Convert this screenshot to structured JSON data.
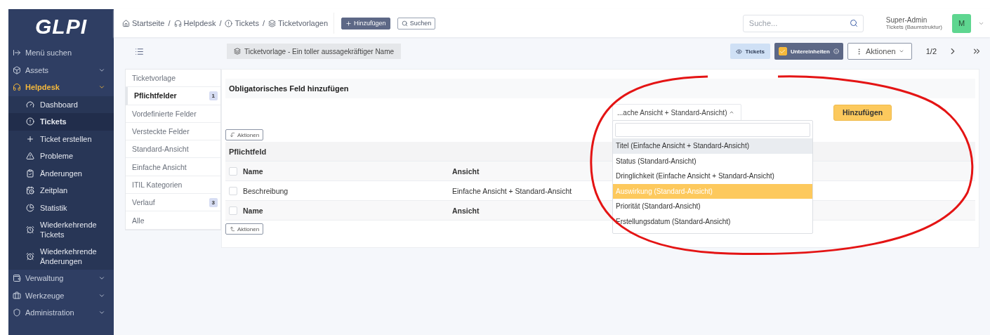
{
  "logo": "GLPI",
  "sidebar": {
    "items": [
      {
        "label": "Menü suchen",
        "expandable": false,
        "active": false
      },
      {
        "label": "Assets",
        "expandable": true,
        "active": false
      },
      {
        "label": "Helpdesk",
        "expandable": true,
        "active": true,
        "children": [
          {
            "label": "Dashboard",
            "selected": false
          },
          {
            "label": "Tickets",
            "selected": true
          },
          {
            "label": "Ticket erstellen",
            "selected": false
          },
          {
            "label": "Probleme",
            "selected": false
          },
          {
            "label": "Änderungen",
            "selected": false
          },
          {
            "label": "Zeitplan",
            "selected": false
          },
          {
            "label": "Statistik",
            "selected": false
          },
          {
            "label": "Wiederkehrende Tickets",
            "selected": false
          },
          {
            "label": "Wiederkehrende Änderungen",
            "selected": false
          }
        ]
      },
      {
        "label": "Verwaltung",
        "expandable": true,
        "active": false
      },
      {
        "label": "Werkzeuge",
        "expandable": true,
        "active": false
      },
      {
        "label": "Administration",
        "expandable": true,
        "active": false
      }
    ]
  },
  "breadcrumb": [
    {
      "kind": "link",
      "label": "Startseite"
    },
    {
      "kind": "separator",
      "label": "/"
    },
    {
      "kind": "link",
      "label": "Helpdesk"
    },
    {
      "kind": "separator",
      "label": "/"
    },
    {
      "kind": "link",
      "label": "Tickets"
    },
    {
      "kind": "separator",
      "label": "/"
    },
    {
      "kind": "link",
      "label": "Ticketvorlagen"
    }
  ],
  "header_buttons": {
    "add": "Hinzufügen",
    "search": "Suchen"
  },
  "global_search": {
    "placeholder": "Suche..."
  },
  "user": {
    "name": "Super-Admin",
    "entity": "Tickets (Baumstruktur)",
    "initial": "M"
  },
  "item_title": "Ticketvorlage - Ein toller aussagekräftiger Name",
  "toolbar": {
    "entity_badge": "Tickets",
    "subentities": {
      "label": "Untereinheiten",
      "checked": true
    },
    "actions": "Aktionen",
    "pager": "1/2"
  },
  "tabs": [
    {
      "label": "Ticketvorlage",
      "selected": false
    },
    {
      "label": "Pflichtfelder",
      "selected": true,
      "count": "1"
    },
    {
      "label": "Vordefinierte Felder",
      "selected": false
    },
    {
      "label": "Versteckte Felder",
      "selected": false
    },
    {
      "label": "Standard-Ansicht",
      "selected": false
    },
    {
      "label": "Einfache Ansicht",
      "selected": false
    },
    {
      "label": "ITIL Kategorien",
      "selected": false
    },
    {
      "label": "Verlauf",
      "selected": false,
      "count": "3"
    },
    {
      "label": "Alle",
      "selected": false
    }
  ],
  "add_section": {
    "title": "Obligatorisches Feld hinzufügen",
    "select_value": "...ache Ansicht + Standard-Ansicht)",
    "button": "Hinzufügen",
    "dropdown": {
      "open": true,
      "options": [
        {
          "label": "Titel (Einfache Ansicht + Standard-Ansicht)",
          "selected": true,
          "highlighted": false
        },
        {
          "label": "Status (Standard-Ansicht)",
          "selected": false,
          "highlighted": false
        },
        {
          "label": "Dringlichkeit (Einfache Ansicht + Standard-Ansicht)",
          "selected": false,
          "highlighted": false
        },
        {
          "label": "Auswirkung (Standard-Ansicht)",
          "selected": false,
          "highlighted": true
        },
        {
          "label": "Priorität (Standard-Ansicht)",
          "selected": false,
          "highlighted": false
        },
        {
          "label": "Erstellungsdatum (Standard-Ansicht)",
          "selected": false,
          "highlighted": false
        }
      ]
    }
  },
  "table": {
    "actions_top": "Aktionen",
    "title": "Pflichtfeld",
    "columns": [
      "Name",
      "Ansicht"
    ],
    "header_checked": false,
    "rows": [
      {
        "cells": [
          "Beschreibung",
          "Einfache Ansicht + Standard-Ansicht"
        ],
        "checked": false
      }
    ],
    "footer_columns": [
      "Name",
      "Ansicht"
    ],
    "footer_checked": false,
    "actions_bottom": "Aktionen"
  }
}
